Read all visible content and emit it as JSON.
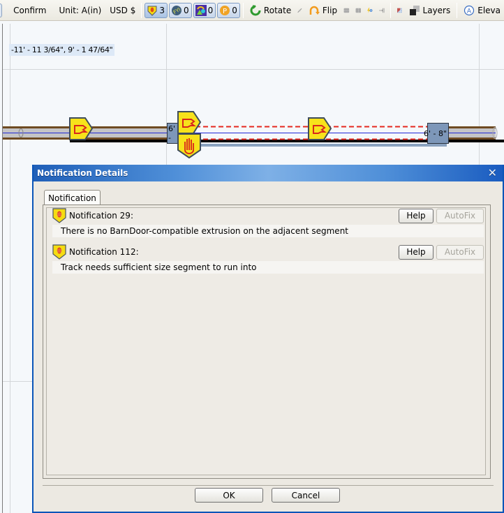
{
  "toolbar": {
    "confirm_label": "Confirm",
    "unit_label": "Unit: A(in)",
    "currency_label": "USD $",
    "badges": [
      {
        "icon": "warning-hand-shield-icon",
        "count": "3"
      },
      {
        "icon": "fyi-icon",
        "count": "0"
      },
      {
        "icon": "shapes-icon",
        "count": "0"
      },
      {
        "icon": "p-circle-icon",
        "count": "0"
      }
    ],
    "rotate_label": "Rotate",
    "flip_label": "Flip",
    "layers_label": "Layers",
    "elevation_label": "Eleva"
  },
  "canvas": {
    "coordinate_readout": "-11' - 11 3/64\", 9' - 1 47/64\"",
    "dimension_left": "6' -",
    "dimension_right": "6' - 8\""
  },
  "dialog": {
    "title": "Notification Details",
    "close_symbol": "✕",
    "tab_label": "Notification",
    "notifications": [
      {
        "title": "Notification 29:",
        "message": "There is no BarnDoor-compatible extrusion on the adjacent segment",
        "help_label": "Help",
        "autofix_label": "AutoFix"
      },
      {
        "title": "Notification 112:",
        "message": "Track needs sufficient size segment to run into",
        "help_label": "Help",
        "autofix_label": "AutoFix"
      }
    ],
    "ok_label": "OK",
    "cancel_label": "Cancel"
  },
  "colors": {
    "dialog_title_blue": "#1f5fb8",
    "warning_yellow": "#f7e21b",
    "warning_red": "#d8261c",
    "dimension_box": "#7d97b9"
  }
}
